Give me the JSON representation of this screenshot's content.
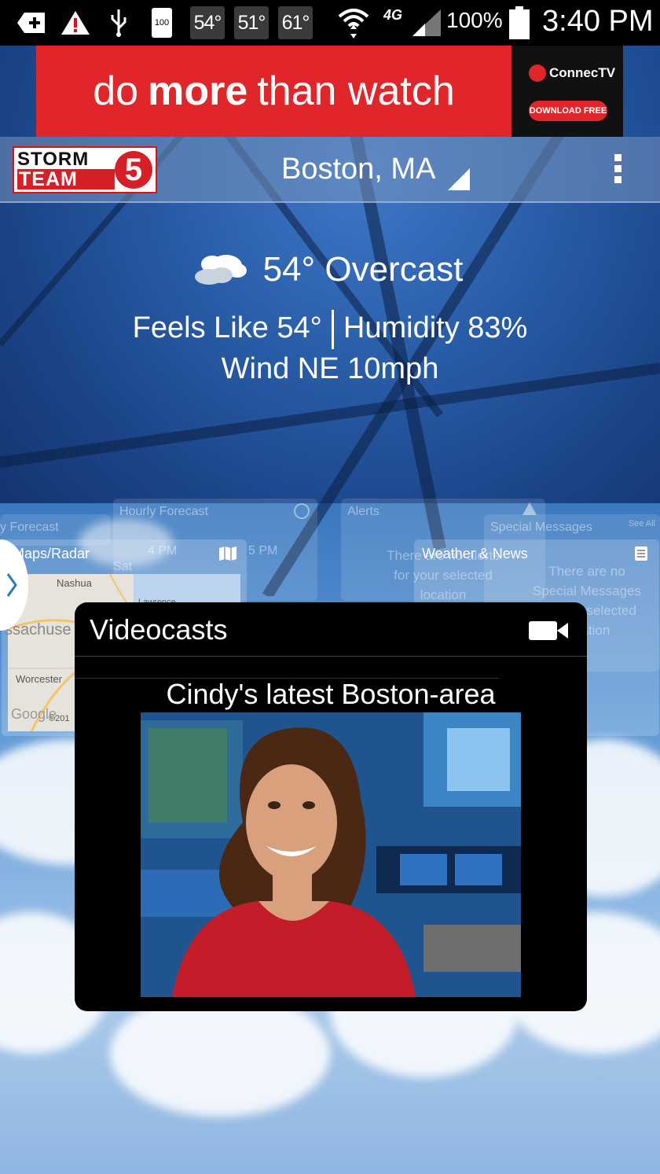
{
  "status_bar": {
    "temps": [
      "54°",
      "51°",
      "61°"
    ],
    "battery_level": "100",
    "network": "4G",
    "battery_percent": "100%",
    "time": "3:40 PM"
  },
  "ad": {
    "text_pre": "do",
    "text_bold": "more",
    "text_post": "than watch",
    "brand": "ConnecTV",
    "button": "DOWNLOAD FREE",
    "color": "#e1262b"
  },
  "header": {
    "logo_top": "STORM",
    "logo_bottom": "TEAM",
    "logo_number": "5",
    "location": "Boston, MA"
  },
  "current": {
    "temp_condition": "54° Overcast",
    "feels_like": "Feels Like 54°",
    "humidity": "Humidity 83%",
    "wind": "Wind NE 10mph"
  },
  "ghost_cards": {
    "daily": "y Forecast",
    "hourly": "Hourly Forecast",
    "hourly_times": [
      "4 PM",
      "5 PM"
    ],
    "hourly_day": "Sat",
    "alerts": "Alerts",
    "alerts_body": "There are no alerts for your selected location",
    "special": "Special Messages",
    "special_see_all": "See All",
    "special_body": "There are no Special Messages for your selected location"
  },
  "maps": {
    "title": "Maps/Radar",
    "labels": [
      "Nashua",
      "Lawrence",
      "ssachuse",
      "Worcester",
      "Google",
      "©201"
    ]
  },
  "weather_news": {
    "title": "Weather & News"
  },
  "videocasts": {
    "title": "Videocasts",
    "caption": "Cindy's latest Boston-area"
  }
}
